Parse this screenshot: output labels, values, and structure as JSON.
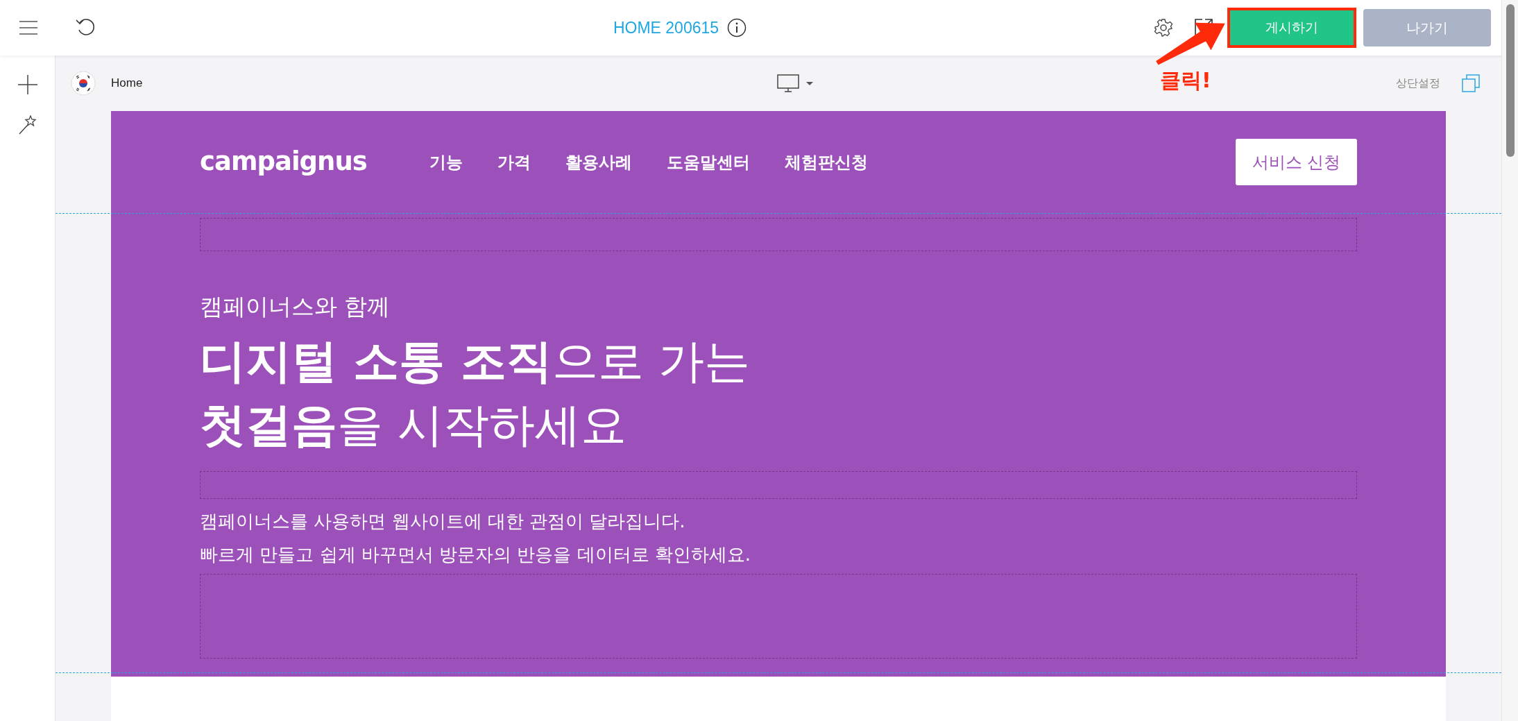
{
  "toolbar": {
    "title": "HOME 200615",
    "publish_button": "게시하기",
    "exit_button": "나가기"
  },
  "page_bar": {
    "page_name": "Home",
    "header_settings": "상단설정"
  },
  "annotation": {
    "text": "클릭!"
  },
  "site": {
    "logo": "campaignus",
    "nav": [
      "기능",
      "가격",
      "활용사례",
      "도움말센터",
      "체험판신청"
    ],
    "cta": "서비스 신청",
    "eyebrow": "캠페이너스와 함께",
    "headline": [
      "**디지털 소통 조직**으로 가는",
      "**첫걸음**을 시작하세요"
    ],
    "description": [
      "캠페이너스를 사용하면 웹사이트에 대한 관점이 달라집니다.",
      "빠르게 만들고 쉽게 바꾸면서 방문자의 반응을 데이터로 확인하세요."
    ]
  }
}
